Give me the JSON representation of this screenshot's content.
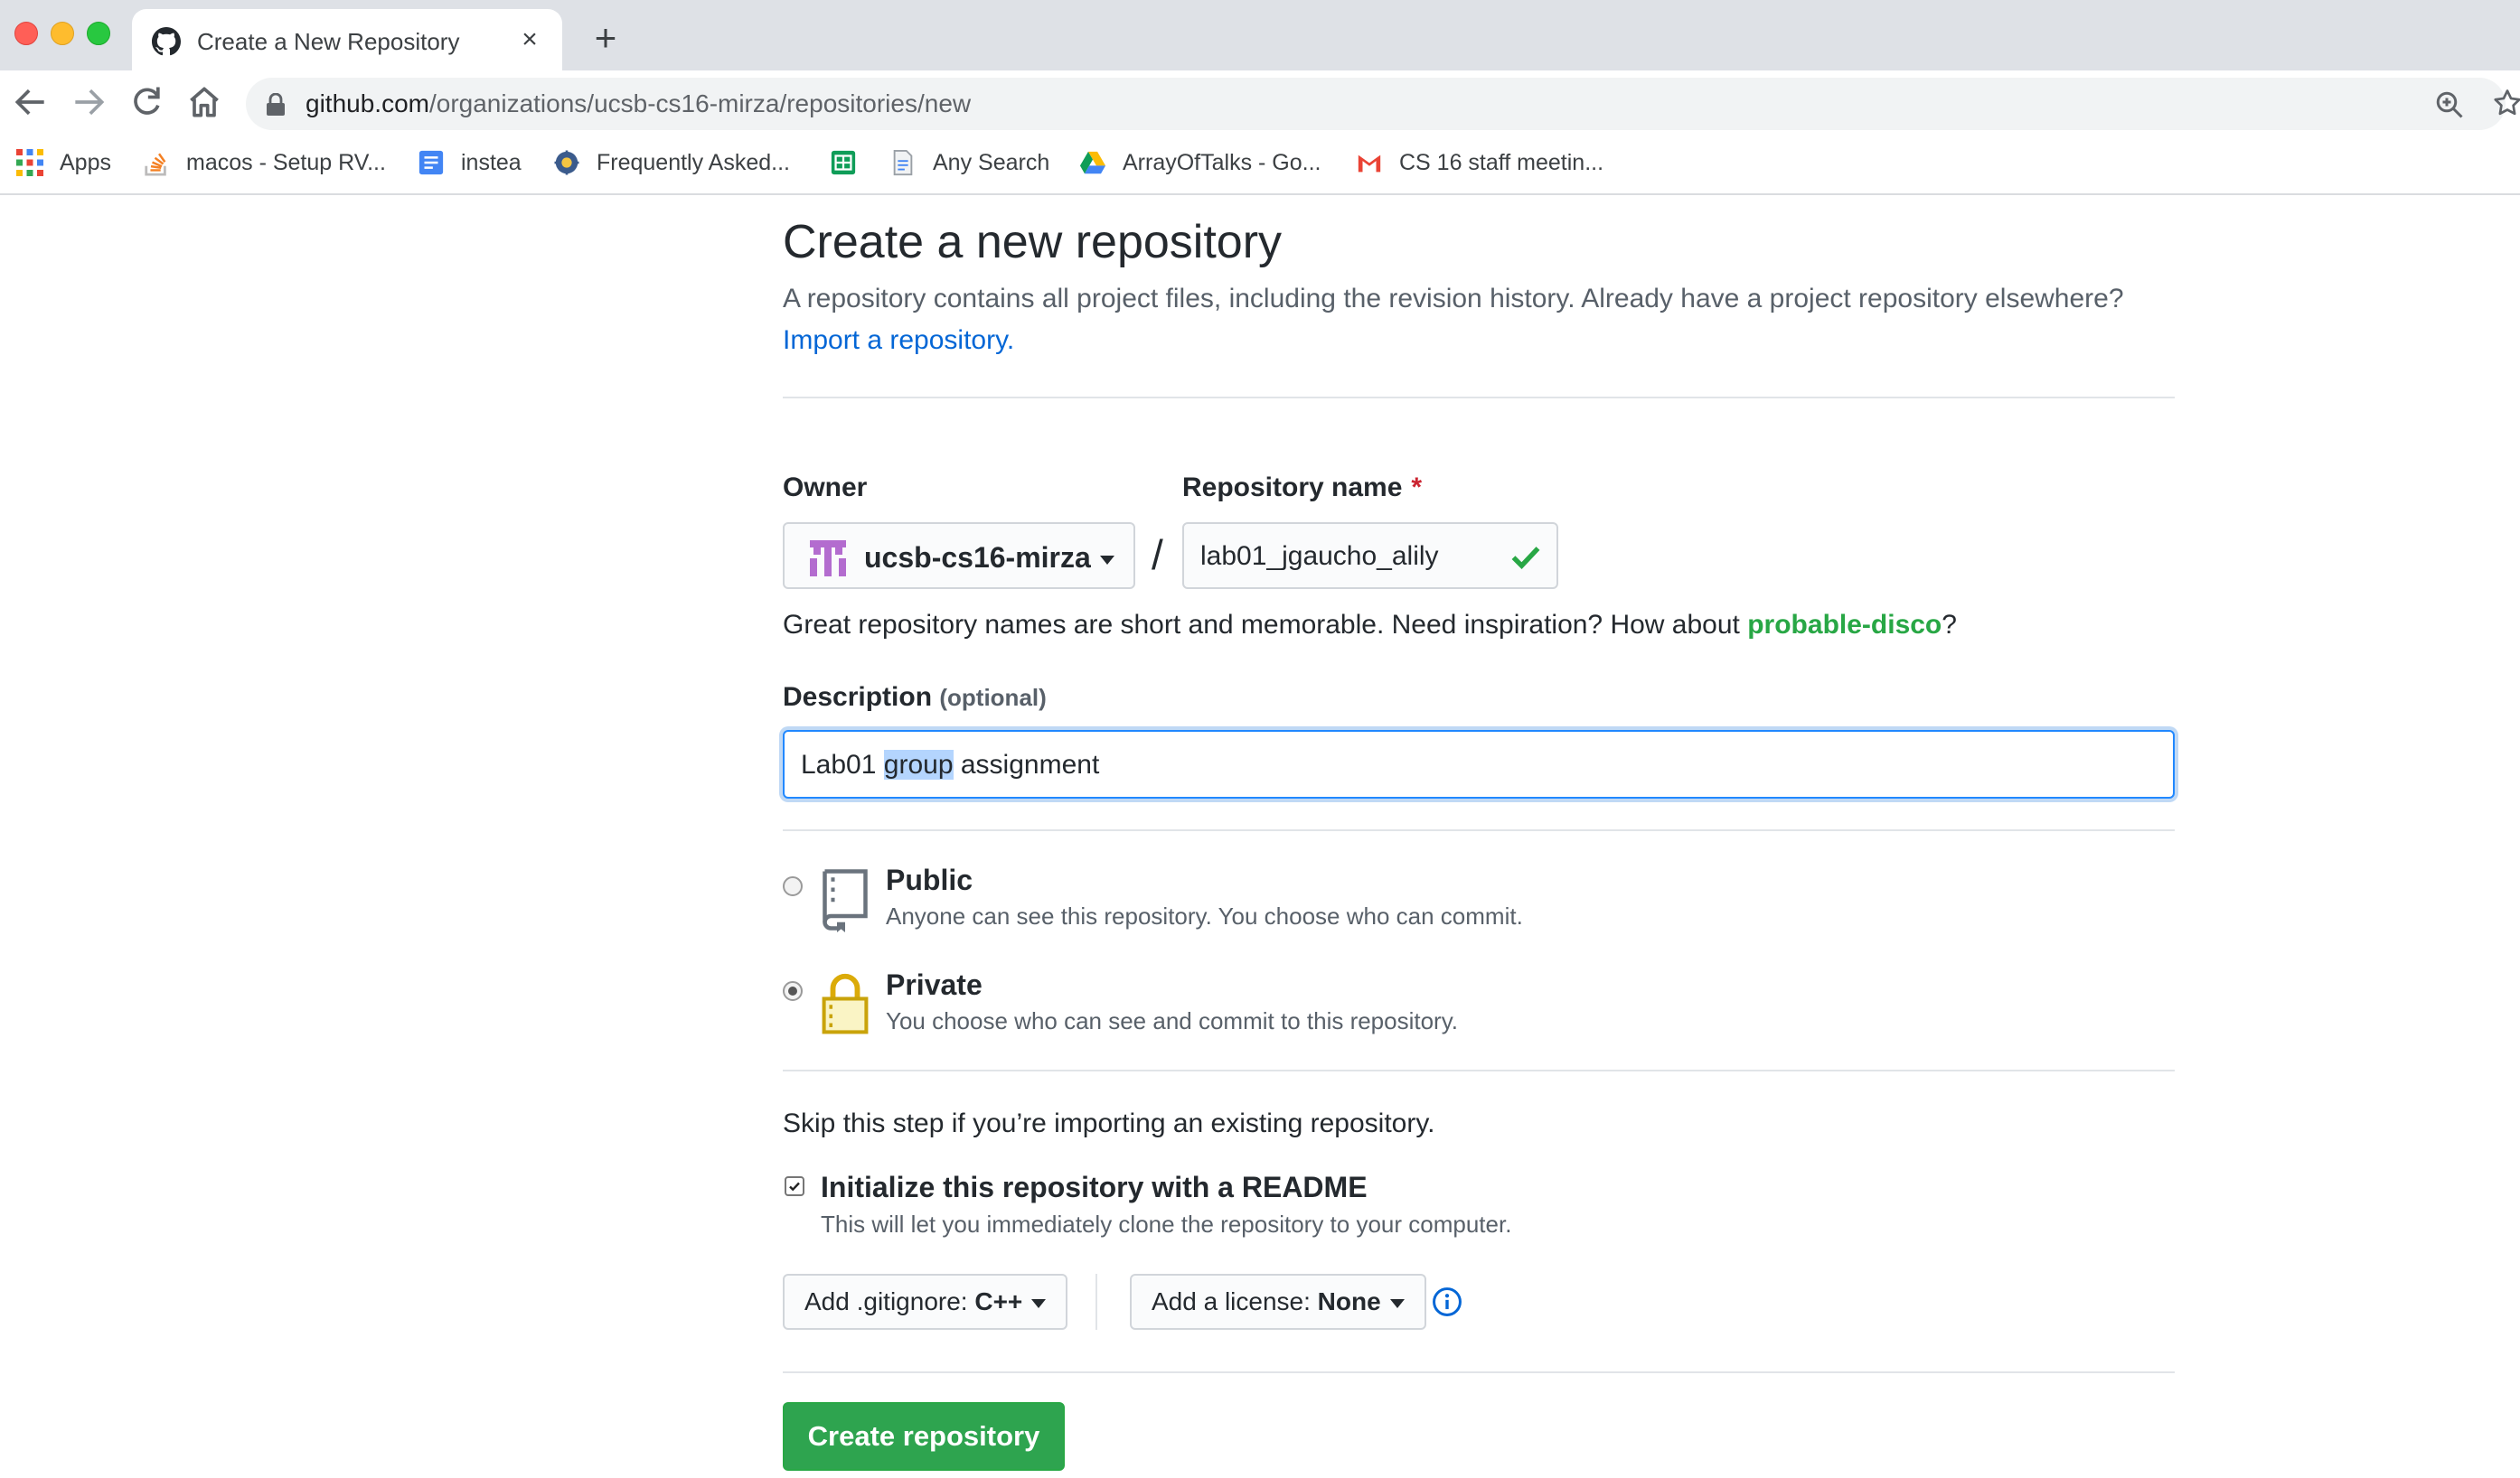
{
  "browser": {
    "tab_title": "Create a New Repository",
    "tab_close": "×",
    "new_tab": "+",
    "url_host": "github.com",
    "url_path": "/organizations/ucsb-cs16-mirza/repositories/new",
    "bookmarks": [
      {
        "label": "Apps",
        "icon": "apps-grid-icon"
      },
      {
        "label": "macos - Setup RV...",
        "icon": "stack-overflow-icon"
      },
      {
        "label": "instea",
        "icon": "google-docs-icon"
      },
      {
        "label": "Frequently Asked...",
        "icon": "site-favicon-icon"
      },
      {
        "label": "",
        "icon": "google-sheets-icon"
      },
      {
        "label": "Any Search",
        "icon": "document-icon"
      },
      {
        "label": "ArrayOfTalks - Go...",
        "icon": "google-drive-icon"
      },
      {
        "label": "CS 16 staff meetin...",
        "icon": "gmail-icon"
      }
    ]
  },
  "page": {
    "title": "Create a new repository",
    "lead_text": "A repository contains all project files, including the revision history. Already have a project repository elsewhere?",
    "import_link": "Import a repository.",
    "owner_label": "Owner",
    "owner_value": "ucsb-cs16-mirza",
    "repo_name_label": "Repository name",
    "required_mark": "*",
    "slash": "/",
    "repo_name_value": "lab01_jgaucho_alily",
    "hint_text": "Great repository names are short and memorable. Need inspiration? How about",
    "hint_suggestion": "probable-disco",
    "hint_end": "?",
    "description_label": "Description",
    "description_optional": "(optional)",
    "description_before": "Lab01",
    "description_selected": "group",
    "description_after": "assignment",
    "visibility": [
      {
        "title": "Public",
        "note": "Anyone can see this repository. You choose who can commit.",
        "selected": false
      },
      {
        "title": "Private",
        "note": "You choose who can see and commit to this repository.",
        "selected": true
      }
    ],
    "skip_text": "Skip this step if you’re importing an existing repository.",
    "init_title": "Initialize this repository with a README",
    "init_note": "This will let you immediately clone the repository to your computer.",
    "init_checked": true,
    "gitignore_label": "Add .gitignore:",
    "gitignore_value": "C++",
    "license_label": "Add a license:",
    "license_value": "None",
    "create_button": "Create repository"
  },
  "colors": {
    "link": "#0366d6",
    "primary_button": "#2ea44f",
    "required": "#cb2431",
    "suggestion": "#28a745",
    "focus_border": "#2188ff"
  }
}
